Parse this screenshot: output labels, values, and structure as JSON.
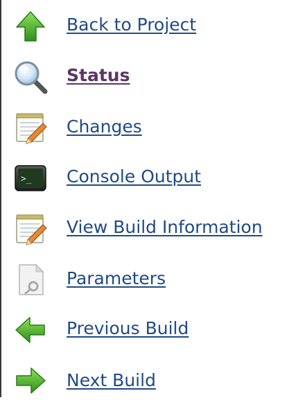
{
  "tasks": [
    {
      "label": "Back to Project",
      "icon": "up-arrow-icon"
    },
    {
      "label": "Status",
      "icon": "search-icon",
      "active": true
    },
    {
      "label": "Changes",
      "icon": "notepad-icon"
    },
    {
      "label": "Console Output",
      "icon": "terminal-icon"
    },
    {
      "label": "View Build Information",
      "icon": "notepad-icon"
    },
    {
      "label": "Parameters",
      "icon": "document-gear-icon"
    },
    {
      "label": "Previous Build",
      "icon": "left-arrow-icon"
    },
    {
      "label": "Next Build",
      "icon": "right-arrow-icon"
    }
  ],
  "colors": {
    "link": "#204a87",
    "active_link": "#5c3566",
    "arrow_green": "#4caf2a"
  }
}
